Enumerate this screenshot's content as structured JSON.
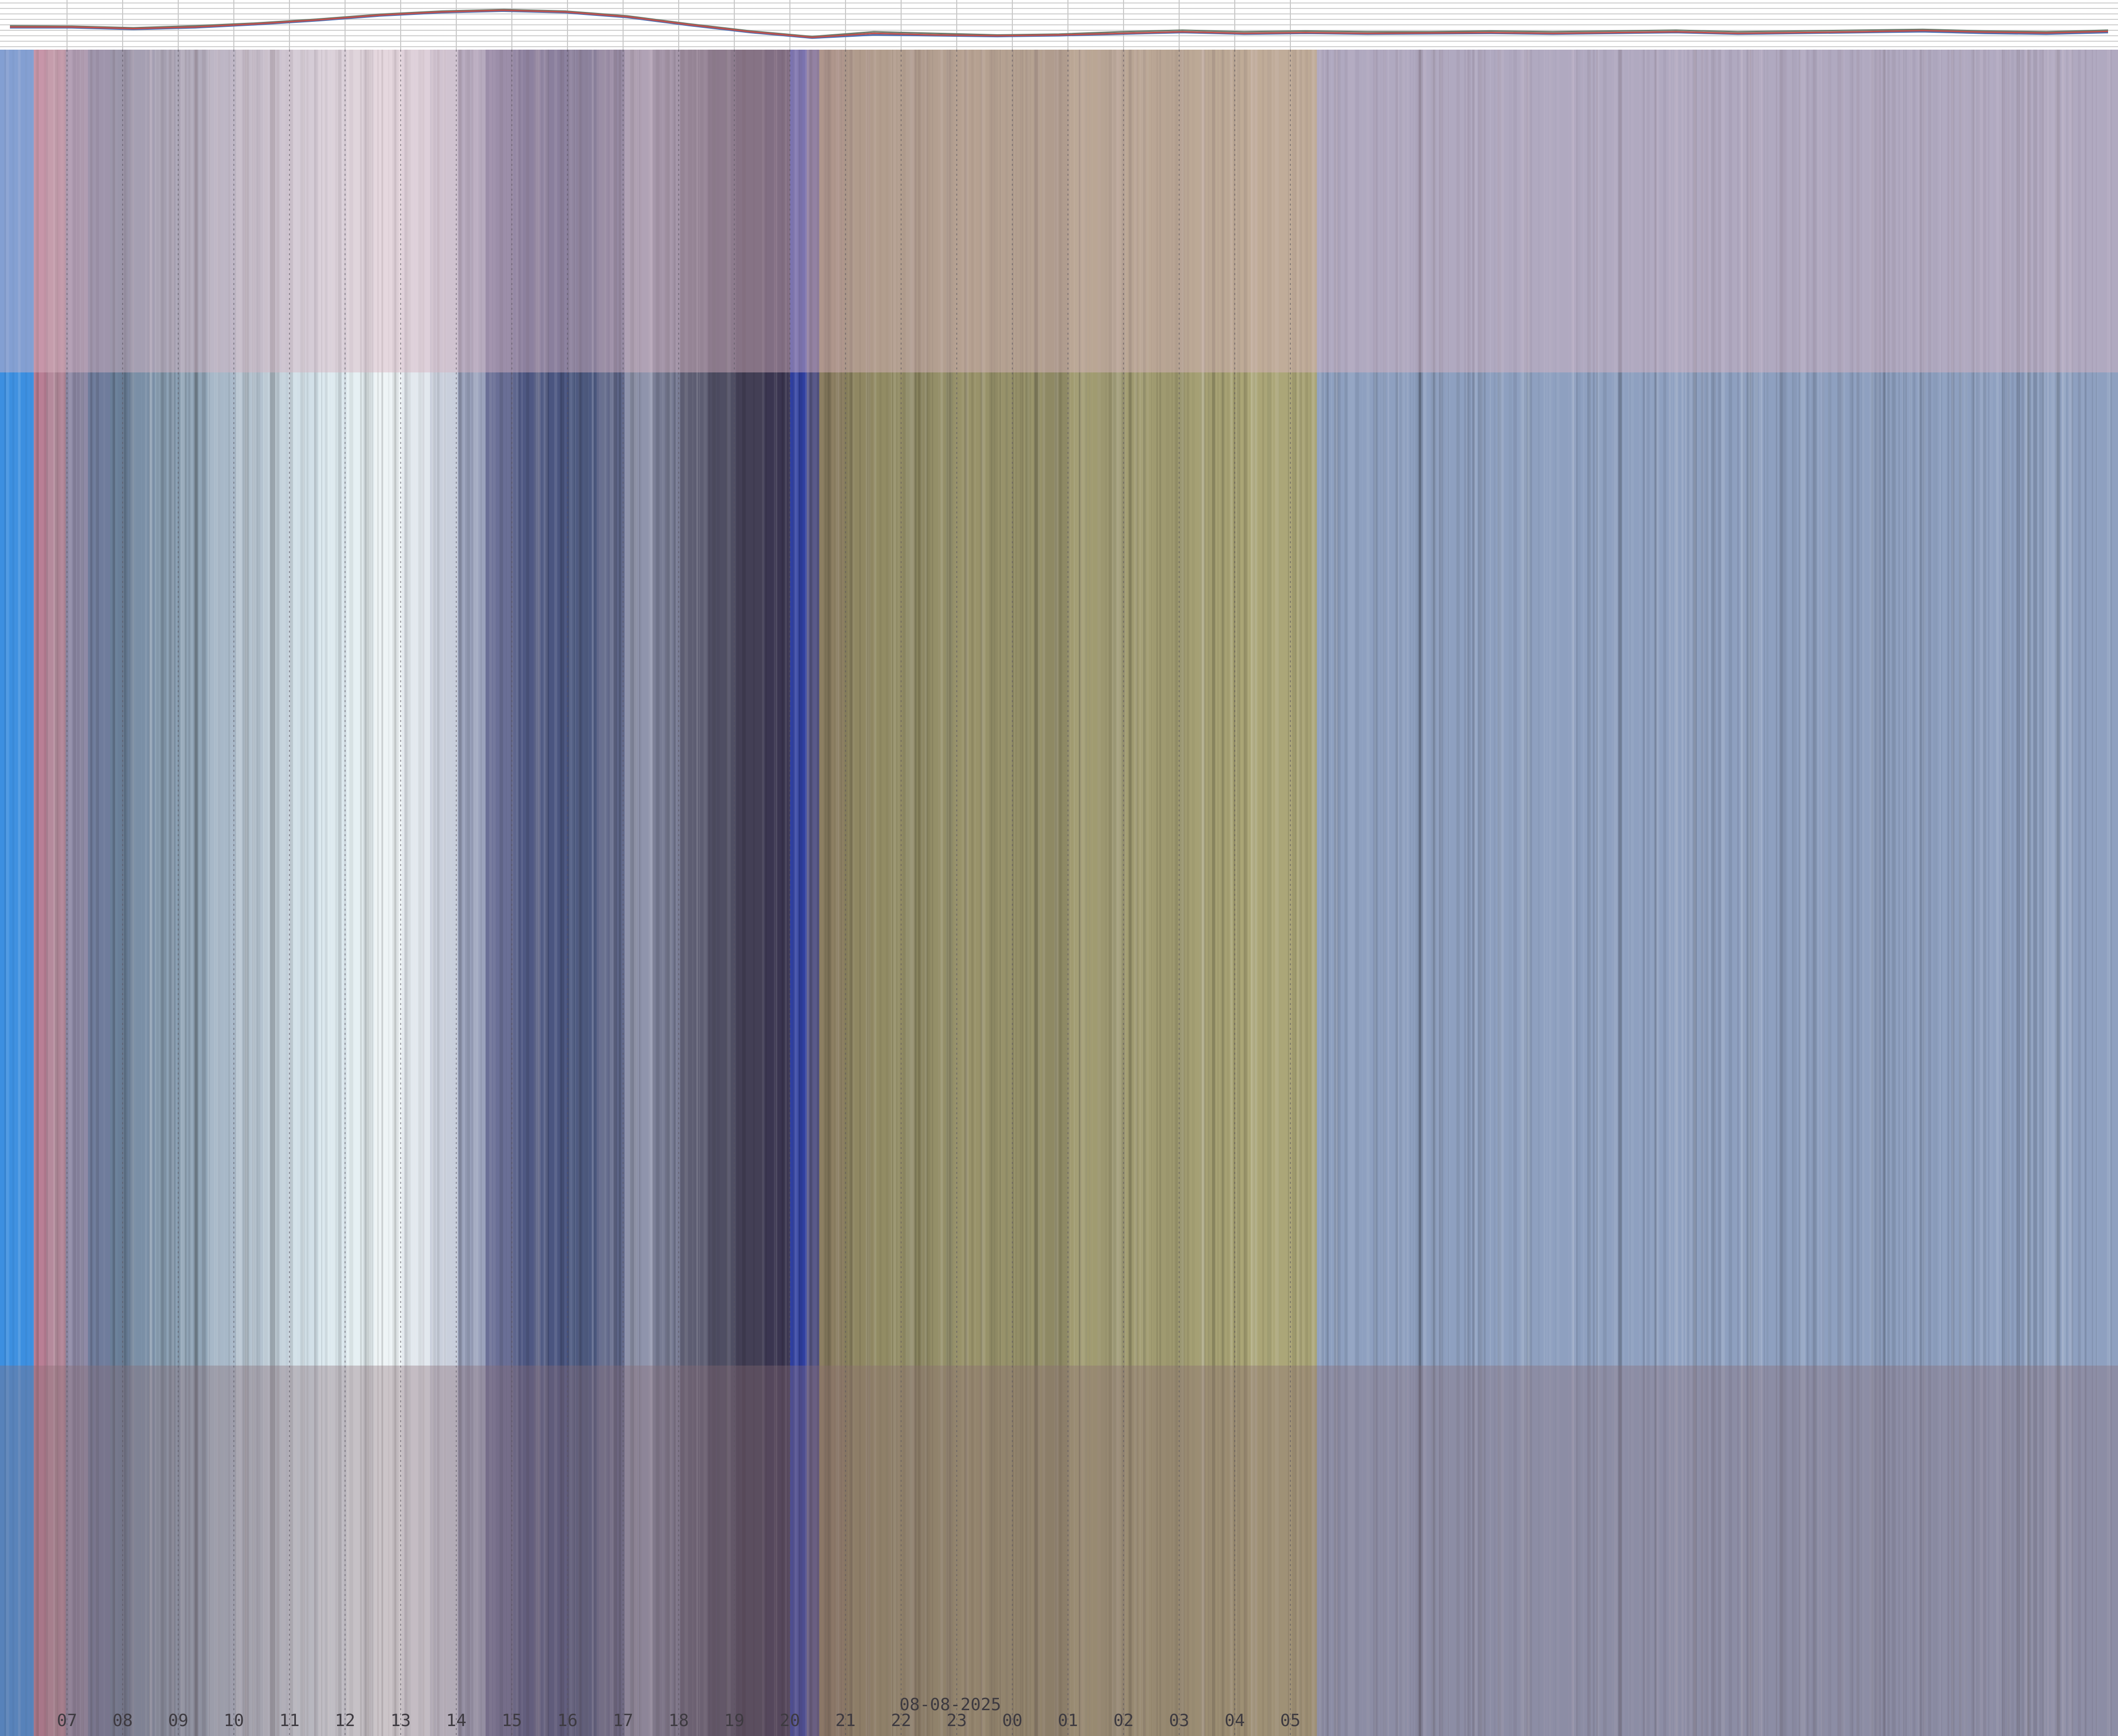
{
  "chart_data": {
    "type": "heatmap",
    "title": "",
    "xlabel": "",
    "ylabel": "",
    "date_label": "08-08-2025",
    "x_ticks": [
      {
        "label": "07",
        "hour": 7
      },
      {
        "label": "08",
        "hour": 8
      },
      {
        "label": "09",
        "hour": 9
      },
      {
        "label": "10",
        "hour": 10
      },
      {
        "label": "11",
        "hour": 11
      },
      {
        "label": "12",
        "hour": 12
      },
      {
        "label": "13",
        "hour": 13
      },
      {
        "label": "14",
        "hour": 14
      },
      {
        "label": "15",
        "hour": 15
      },
      {
        "label": "16",
        "hour": 16
      },
      {
        "label": "17",
        "hour": 17
      },
      {
        "label": "18",
        "hour": 18
      },
      {
        "label": "19",
        "hour": 19
      },
      {
        "label": "20",
        "hour": 20
      },
      {
        "label": "21",
        "hour": 21
      },
      {
        "label": "22",
        "hour": 22
      },
      {
        "label": "23",
        "hour": 23
      },
      {
        "label": "00",
        "hour": 24
      },
      {
        "label": "01",
        "hour": 25
      },
      {
        "label": "02",
        "hour": 26
      },
      {
        "label": "03",
        "hour": 27
      },
      {
        "label": "04",
        "hour": 28
      },
      {
        "label": "05",
        "hour": 29
      }
    ],
    "grid": true,
    "top_panel": {
      "type": "line",
      "series": [
        {
          "color": "#6b7a6b",
          "values": [
            0.45,
            0.44,
            0.4,
            0.45,
            0.52,
            0.62,
            0.74,
            0.82,
            0.86,
            0.82,
            0.7,
            0.5,
            0.32,
            0.18,
            0.3,
            0.26,
            0.22,
            0.24,
            0.3,
            0.34,
            0.3,
            0.32,
            0.3,
            0.3,
            0.32,
            0.3,
            0.32,
            0.34,
            0.3,
            0.32,
            0.34,
            0.36,
            0.32,
            0.3,
            0.34
          ]
        },
        {
          "color": "#4a6fb5",
          "values": [
            0.4,
            0.4,
            0.36,
            0.4,
            0.48,
            0.58,
            0.7,
            0.78,
            0.82,
            0.78,
            0.66,
            0.46,
            0.28,
            0.14,
            0.22,
            0.2,
            0.18,
            0.2,
            0.24,
            0.28,
            0.24,
            0.26,
            0.24,
            0.25,
            0.26,
            0.24,
            0.26,
            0.28,
            0.24,
            0.26,
            0.28,
            0.3,
            0.26,
            0.24,
            0.28
          ]
        },
        {
          "color": "#c0504d",
          "values": [
            0.42,
            0.42,
            0.38,
            0.42,
            0.5,
            0.6,
            0.72,
            0.8,
            0.84,
            0.8,
            0.68,
            0.48,
            0.3,
            0.16,
            0.26,
            0.22,
            0.2,
            0.22,
            0.26,
            0.3,
            0.26,
            0.28,
            0.26,
            0.27,
            0.28,
            0.26,
            0.28,
            0.3,
            0.26,
            0.28,
            0.3,
            0.33,
            0.29,
            0.27,
            0.31
          ]
        }
      ]
    },
    "columns": [
      {
        "hour": 6.55,
        "color": "#3c8fe0"
      },
      {
        "hour": 6.7,
        "color": "#b97f95"
      },
      {
        "hour": 7.0,
        "color": "#b58a9c"
      },
      {
        "hour": 7.4,
        "color": "#8e8aa6"
      },
      {
        "hour": 7.8,
        "color": "#6f7c9c"
      },
      {
        "hour": 8.2,
        "color": "#697e98"
      },
      {
        "hour": 8.6,
        "color": "#7a8fa6"
      },
      {
        "hour": 9.0,
        "color": "#8aa0b4"
      },
      {
        "hour": 9.5,
        "color": "#92a6b8"
      },
      {
        "hour": 10.0,
        "color": "#a7b8c8"
      },
      {
        "hour": 10.5,
        "color": "#b4c3d0"
      },
      {
        "hour": 11.0,
        "color": "#c4d2dc"
      },
      {
        "hour": 11.5,
        "color": "#d2e0e8"
      },
      {
        "hour": 12.0,
        "color": "#dce9ef"
      },
      {
        "hour": 12.5,
        "color": "#e6f0f3"
      },
      {
        "hour": 13.0,
        "color": "#eef4f6"
      },
      {
        "hour": 13.5,
        "color": "#e2e8ee"
      },
      {
        "hour": 14.0,
        "color": "#c9cfdc"
      },
      {
        "hour": 14.5,
        "color": "#9aa2bc"
      },
      {
        "hour": 15.0,
        "color": "#6a6f96"
      },
      {
        "hour": 15.5,
        "color": "#4f5883"
      },
      {
        "hour": 16.0,
        "color": "#4a5580"
      },
      {
        "hour": 16.5,
        "color": "#4d5a82"
      },
      {
        "hour": 17.0,
        "color": "#5e6689"
      },
      {
        "hour": 17.5,
        "color": "#8f94ac"
      },
      {
        "hour": 18.0,
        "color": "#787c94"
      },
      {
        "hour": 18.5,
        "color": "#5d5d72"
      },
      {
        "hour": 19.0,
        "color": "#4f4e63"
      },
      {
        "hour": 19.5,
        "color": "#433f55"
      },
      {
        "hour": 20.0,
        "color": "#3a3550"
      },
      {
        "hour": 20.45,
        "color": "#2f3fa0"
      },
      {
        "hour": 20.6,
        "color": "#5a5a8a"
      },
      {
        "hour": 20.9,
        "color": "#8c7f62"
      },
      {
        "hour": 21.5,
        "color": "#8f8762"
      },
      {
        "hour": 22.0,
        "color": "#928c64"
      },
      {
        "hour": 22.5,
        "color": "#8a8560"
      },
      {
        "hour": 23.0,
        "color": "#948f68"
      },
      {
        "hour": 23.5,
        "color": "#99936a"
      },
      {
        "hour": 24.0,
        "color": "#97926a"
      },
      {
        "hour": 24.5,
        "color": "#9a956c"
      },
      {
        "hour": 25.0,
        "color": "#8e8964"
      },
      {
        "hour": 25.5,
        "color": "#a09b70"
      },
      {
        "hour": 26.0,
        "color": "#9c9770"
      },
      {
        "hour": 26.5,
        "color": "#a29d72"
      },
      {
        "hour": 27.0,
        "color": "#9f9a70"
      },
      {
        "hour": 27.5,
        "color": "#a5a074"
      },
      {
        "hour": 28.0,
        "color": "#a7a274"
      },
      {
        "hour": 28.5,
        "color": "#aaa576"
      },
      {
        "hour": 29.0,
        "color": "#aba678"
      },
      {
        "hour": 29.5,
        "color": "#a9a476"
      },
      {
        "hour": 29.9,
        "color": "#8ea0c0"
      }
    ],
    "colors": {
      "top_tint": "#d9b3c0",
      "bottom_tint": "#8a6a72",
      "grid_line": "#5a5560",
      "background": "#ffffff"
    }
  }
}
